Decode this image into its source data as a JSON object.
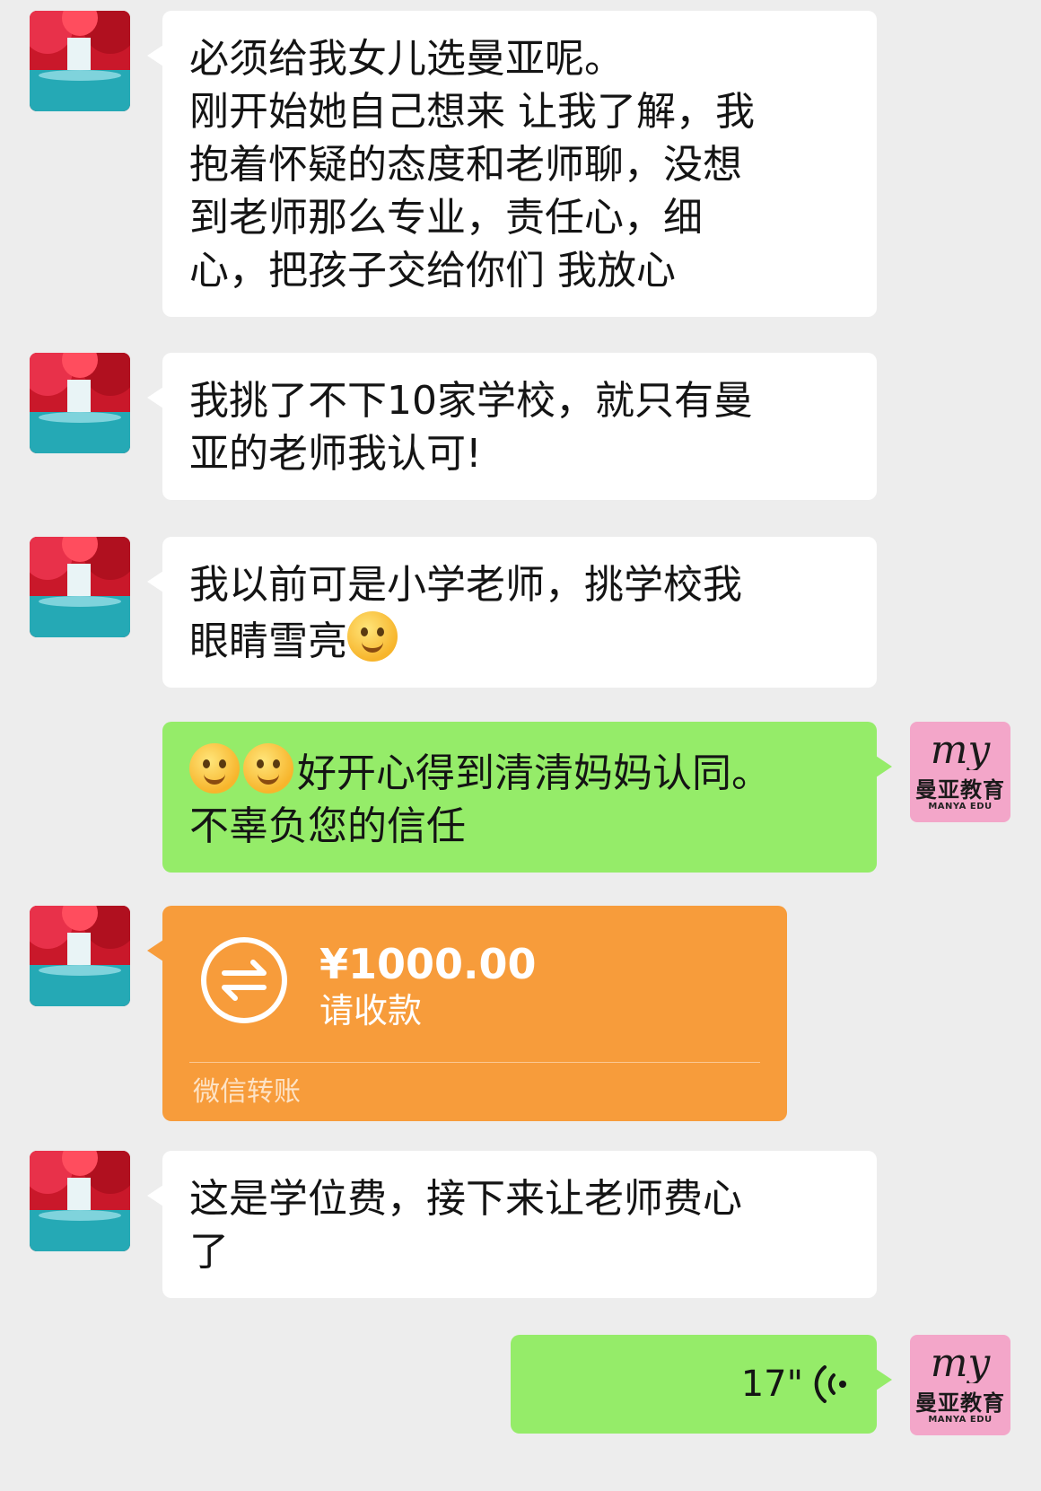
{
  "brand": {
    "logo_text": "my",
    "name": "曼亚教育",
    "sub": "MANYA EDU"
  },
  "messages": [
    {
      "sender": "friend",
      "lines": [
        "必须给我女儿选曼亚呢。",
        "刚开始她自己想来 让我了解，我",
        "抱着怀疑的态度和老师聊，没想",
        "到老师那么专业，责任心，细",
        "心，把孩子交给你们 我放心"
      ]
    },
    {
      "sender": "friend",
      "lines": [
        "我挑了不下10家学校，就只有曼",
        "亚的老师我认可!"
      ]
    },
    {
      "sender": "friend",
      "lines": [
        "我以前可是小学老师，挑学校我",
        "眼睛雪亮"
      ],
      "trailing_emoji": "face-with-hand-over-mouth"
    },
    {
      "sender": "self",
      "leading_emojis": [
        "hugging-face",
        "hugging-face"
      ],
      "lines": [
        "好开心得到清清妈妈认同。",
        "不辜负您的信任"
      ]
    },
    {
      "sender": "friend",
      "type": "transfer",
      "amount": "¥1000.00",
      "label": "请收款",
      "footer": "微信转账",
      "icon": "transfer-arrows-icon"
    },
    {
      "sender": "friend",
      "lines": [
        "这是学位费，接下来让老师费心",
        "了"
      ]
    },
    {
      "sender": "self",
      "type": "voice",
      "duration": "17\"",
      "icon": "voice-wave-icon"
    }
  ],
  "colors": {
    "background": "#ededed",
    "friend_bubble": "#ffffff",
    "self_bubble": "#95ec69",
    "transfer_card": "#f79c3b",
    "brand_avatar": "#f3a6c9"
  }
}
